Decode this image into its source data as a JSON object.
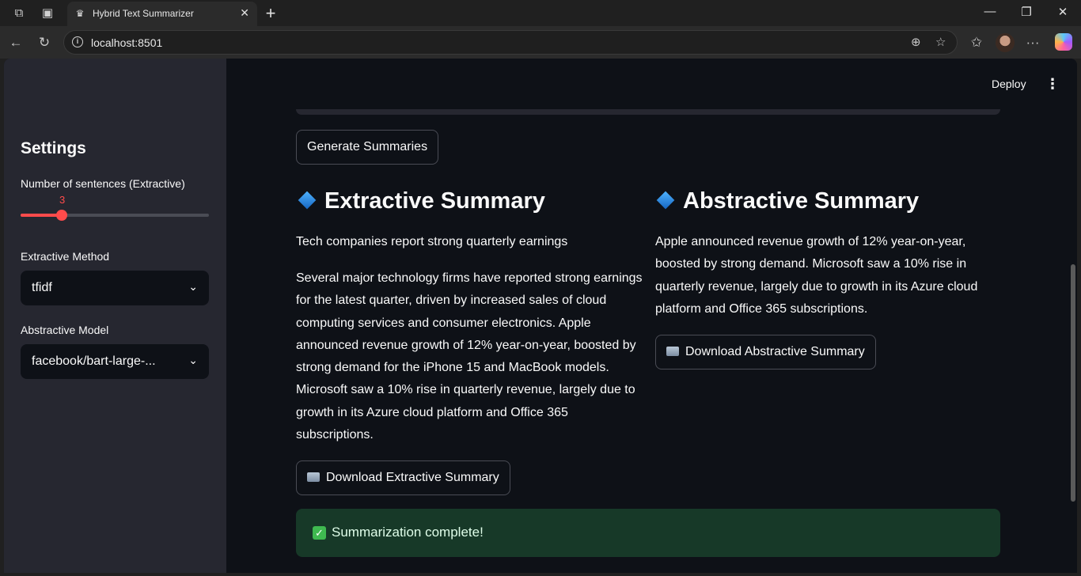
{
  "browser": {
    "tab_title": "Hybrid Text Summarizer",
    "url": "localhost:8501",
    "new_tab": "+",
    "tab_close": "✕"
  },
  "sidebar": {
    "title": "Settings",
    "slider": {
      "label": "Number of sentences (Extractive)",
      "value": "3",
      "fraction": 0.22
    },
    "method": {
      "label": "Extractive Method",
      "value": "tfidf"
    },
    "model": {
      "label": "Abstractive Model",
      "value": "facebook/bart-large-..."
    }
  },
  "header": {
    "deploy": "Deploy"
  },
  "main": {
    "generate_button": "Generate Summaries",
    "extractive": {
      "title": "Extractive Summary",
      "headline": "Tech companies report strong quarterly earnings",
      "body": "Several major technology firms have reported strong earnings for the latest quarter, driven by increased sales of cloud computing services and consumer electronics. Apple announced revenue growth of 12% year-on-year, boosted by strong demand for the iPhone 15 and MacBook models. Microsoft saw a 10% rise in quarterly revenue, largely due to growth in its Azure cloud platform and Office 365 subscriptions.",
      "download": "Download Extractive Summary"
    },
    "abstractive": {
      "title": "Abstractive Summary",
      "body": "Apple announced revenue growth of 12% year-on-year, boosted by strong demand. Microsoft saw a 10% rise in quarterly revenue, largely due to growth in its Azure cloud platform and Office 365 subscriptions.",
      "download": "Download Abstractive Summary"
    },
    "success": "Summarization complete!"
  },
  "colors": {
    "accent": "#ff4b4b",
    "background": "#0e1117",
    "sidebar": "#262730",
    "success_bg": "#173928"
  }
}
